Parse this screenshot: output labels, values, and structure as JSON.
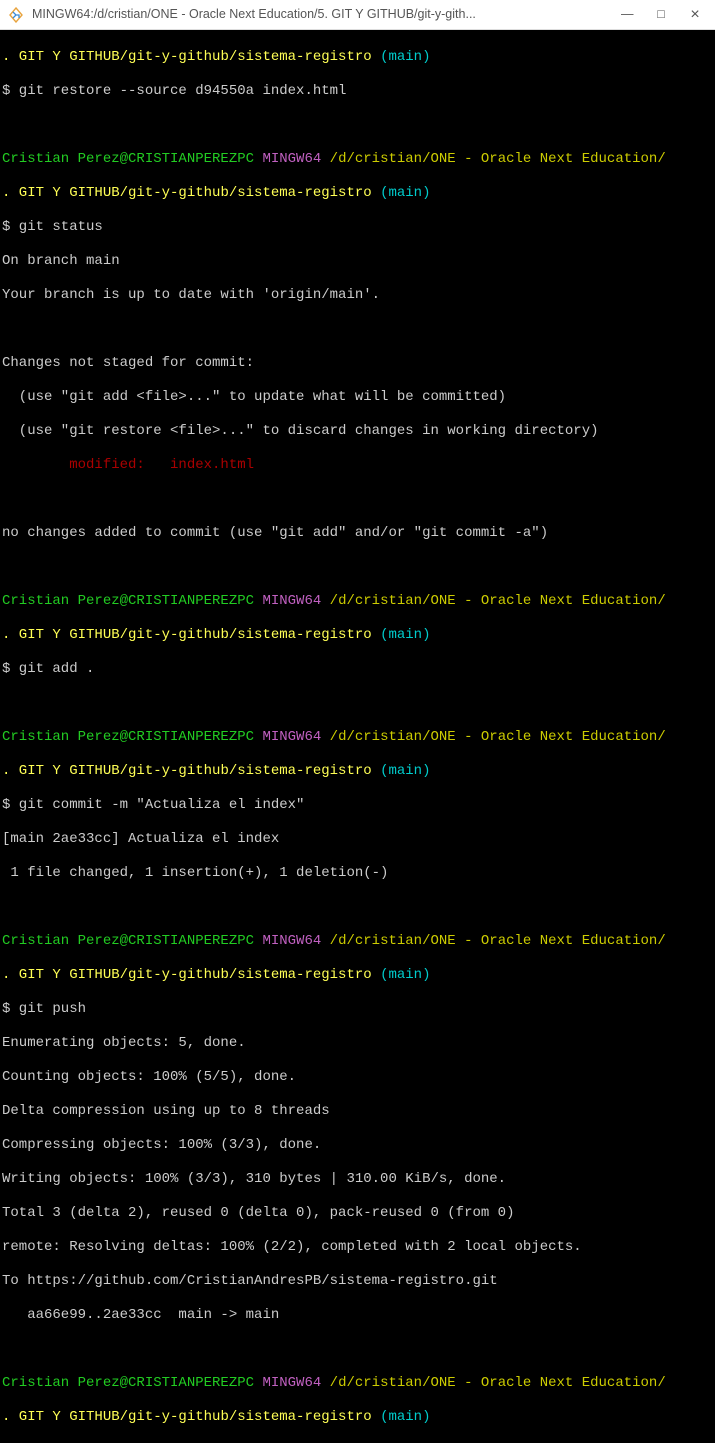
{
  "titlebar": {
    "title": "MINGW64:/d/cristian/ONE - Oracle Next Education/5. GIT Y GITHUB/git-y-gith...",
    "min": "—",
    "max": "□",
    "close": "×"
  },
  "prompt": {
    "user": "Cristian Perez@CRISTIANPEREZPC",
    "env": "MINGW64",
    "cwd": "/d/cristian/ONE - Oracle Next Education/",
    "dot": ".",
    "path2": " GIT Y GITHUB/git-y-github/sistema-registro",
    "branch": " (main)"
  },
  "cmd": {
    "restore": "$ git restore --source d94550a index.html",
    "status": "$ git status",
    "add": "$ git add .",
    "commit": "$ git commit -m \"Actualiza el index\"",
    "push": "$ git push"
  },
  "status": {
    "on_branch": "On branch main",
    "uptodate": "Your branch is up to date with 'origin/main'.",
    "not_staged": "Changes not staged for commit:",
    "hint_add": "  (use \"git add <file>...\" to update what will be committed)",
    "hint_restore": "  (use \"git restore <file>...\" to discard changes in working directory)",
    "modified": "        modified:   index.html",
    "no_changes": "no changes added to commit (use \"git add\" and/or \"git commit -a\")"
  },
  "commit_out": {
    "l1": "[main 2ae33cc] Actualiza el index",
    "l2": " 1 file changed, 1 insertion(+), 1 deletion(-)"
  },
  "push_out": {
    "l1": "Enumerating objects: 5, done.",
    "l2": "Counting objects: 100% (5/5), done.",
    "l3": "Delta compression using up to 8 threads",
    "l4": "Compressing objects: 100% (3/3), done.",
    "l5": "Writing objects: 100% (3/3), 310 bytes | 310.00 KiB/s, done.",
    "l6": "Total 3 (delta 2), reused 0 (delta 0), pack-reused 0 (from 0)",
    "l7": "remote: Resolving deltas: 100% (2/2), completed with 2 local objects.",
    "l8": "To https://github.com/CristianAndresPB/sistema-registro.git",
    "l9": "   aa66e99..2ae33cc  main -> main"
  }
}
